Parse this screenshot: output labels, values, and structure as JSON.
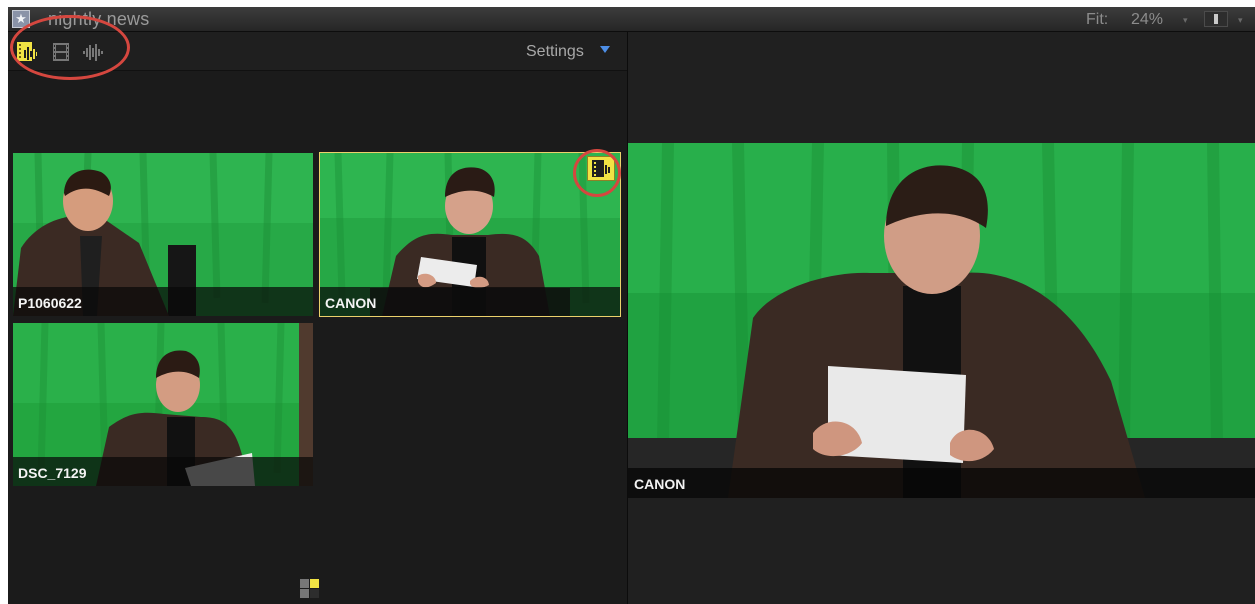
{
  "window": {
    "title": "nightly news",
    "zoom_label": "Fit:",
    "zoom_value": "24%"
  },
  "angle_panel": {
    "tools": [
      {
        "icon": "video-and-audio-icon",
        "state": "active"
      },
      {
        "icon": "video-only-icon",
        "state": "inactive"
      },
      {
        "icon": "audio-only-icon",
        "state": "inactive"
      }
    ],
    "settings_label": "Settings",
    "angles": [
      {
        "label": "P1060622",
        "active": false
      },
      {
        "label": "CANON",
        "active": true
      },
      {
        "label": "DSC_7129",
        "active": false
      }
    ]
  },
  "viewer": {
    "angle_label": "CANON"
  },
  "colors": {
    "accent_yellow": "#f1e344",
    "callout_red": "#d5473f",
    "settings_blue": "#4d8ee6",
    "green_screen": "#22a93a"
  }
}
